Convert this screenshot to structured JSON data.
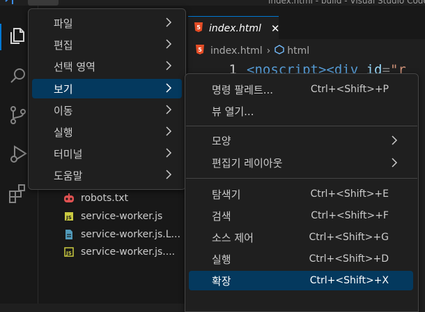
{
  "window": {
    "title": "index.html - build - Visual Studio Code"
  },
  "main_menu": {
    "items": [
      {
        "label": "파일"
      },
      {
        "label": "편집"
      },
      {
        "label": "선택 영역"
      },
      {
        "label": "보기"
      },
      {
        "label": "이동"
      },
      {
        "label": "실행"
      },
      {
        "label": "터미널"
      },
      {
        "label": "도움말"
      }
    ],
    "active": "보기"
  },
  "view_menu": {
    "groups": [
      [
        {
          "label": "명령 팔레트...",
          "shortcut": "Ctrl+<Shift>+P"
        },
        {
          "label": "뷰 열기...",
          "shortcut": ""
        }
      ],
      [
        {
          "label": "모양",
          "shortcut": ""
        },
        {
          "label": "편집기 레이아웃",
          "shortcut": ""
        }
      ],
      [
        {
          "label": "탐색기",
          "shortcut": "Ctrl+<Shift>+E"
        },
        {
          "label": "검색",
          "shortcut": "Ctrl+<Shift>+F"
        },
        {
          "label": "소스 제어",
          "shortcut": "Ctrl+<Shift>+G"
        },
        {
          "label": "실행",
          "shortcut": "Ctrl+<Shift>+D"
        },
        {
          "label": "확장",
          "shortcut": "Ctrl+<Shift>+X"
        }
      ]
    ],
    "highlighted": "확장"
  },
  "explorer": {
    "files": [
      {
        "name": "robots.txt",
        "icon": "robot-icon"
      },
      {
        "name": "service-worker.js",
        "icon": "js-file-icon"
      },
      {
        "name": "service-worker.js.L...",
        "icon": "file-icon"
      },
      {
        "name": "service-worker.js....",
        "icon": "js-file-icon"
      }
    ]
  },
  "editor": {
    "tab_label": "index.html",
    "breadcrumb": [
      "index.html",
      "html"
    ],
    "line_number": "1",
    "code": {
      "open_noscript": "<noscript>",
      "open_div": "<div",
      "attr": "id",
      "eq": "=",
      "val": "\"r"
    }
  },
  "colors": {
    "accent": "#0078d4",
    "menu_highlight": "#04395e",
    "html_icon": "#e44d26",
    "js_icon": "#cbcb41",
    "robot_icon": "#e05252"
  }
}
